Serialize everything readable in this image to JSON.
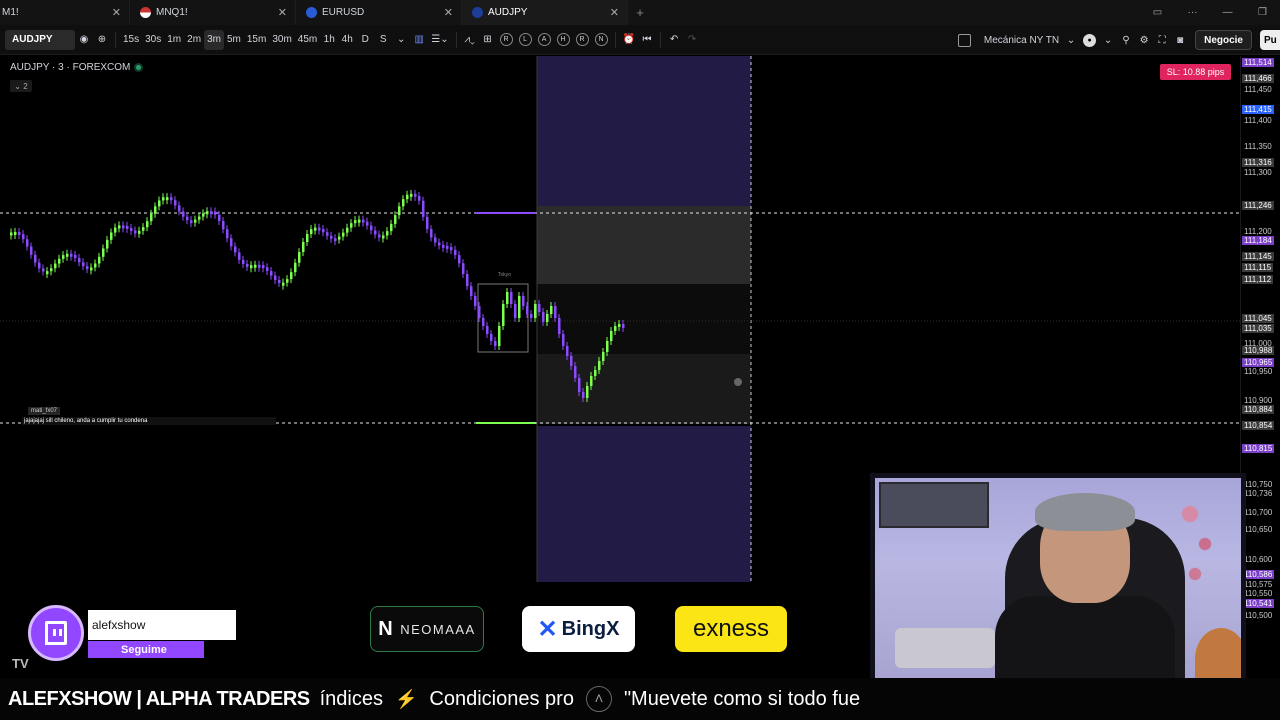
{
  "tabs": [
    {
      "label": "M1!",
      "icon": "none"
    },
    {
      "label": "MNQ1!",
      "icon": "us-flag-icon"
    },
    {
      "label": "EURUSD",
      "icon": "eu-flag-icon"
    },
    {
      "label": "AUDJPY",
      "icon": "au-flag-icon",
      "active": true
    }
  ],
  "toolbar": {
    "symbol": "AUDJPY",
    "intervals": [
      "15s",
      "30s",
      "1m",
      "2m",
      "3m",
      "5m",
      "15m",
      "30m",
      "45m",
      "1h",
      "4h",
      "D",
      "S"
    ],
    "selected_interval": "3m",
    "replay_letters": [
      "R",
      "L",
      "A",
      "H",
      "R",
      "N"
    ],
    "template_name": "Mecánica NY TN",
    "trade_button": "Negocie",
    "publish_button": "Pu"
  },
  "chart": {
    "legend": "AUDJPY · 3 · FOREXCOM",
    "collapse_label": "2",
    "sl_badge": "SL: 10.88 pips",
    "tokyo_label": "Tokyo",
    "chat_user": "mati_fx07",
    "chat_message": "jajajajaj sill chileno, anda a cumplir tu condena",
    "price_labels": [
      {
        "text": "111,514",
        "style": "badge-purple"
      },
      {
        "text": "111,466",
        "style": "badge-gray"
      },
      {
        "text": "111,450",
        "style": "plain"
      },
      {
        "text": "111,415",
        "style": "badge-blue"
      },
      {
        "text": "111,400",
        "style": "plain"
      },
      {
        "text": "111,350",
        "style": "plain"
      },
      {
        "text": "111,316",
        "style": "badge-gray"
      },
      {
        "text": "111,300",
        "style": "plain"
      },
      {
        "text": "111,246",
        "style": "badge-gray"
      },
      {
        "text": "111,200",
        "style": "plain"
      },
      {
        "text": "111,184",
        "style": "badge-purple"
      },
      {
        "text": "111,145",
        "style": "badge-gray"
      },
      {
        "text": "111,115",
        "style": "badge-gray"
      },
      {
        "text": "111,112",
        "style": "badge-gray"
      },
      {
        "text": "111,045",
        "style": "badge-gray"
      },
      {
        "text": "111,035",
        "style": "badge-gray"
      },
      {
        "text": "111,000",
        "style": "plain"
      },
      {
        "text": "110,988",
        "style": "badge-gray"
      },
      {
        "text": "110,965",
        "style": "badge-purple"
      },
      {
        "text": "110,950",
        "style": "plain"
      },
      {
        "text": "110,900",
        "style": "plain"
      },
      {
        "text": "110,884",
        "style": "badge-gray"
      },
      {
        "text": "110,854",
        "style": "badge-gray"
      },
      {
        "text": "110,815",
        "style": "badge-purple"
      },
      {
        "text": "110,750",
        "style": "plain"
      },
      {
        "text": "110,736",
        "style": "plain"
      },
      {
        "text": "110,700",
        "style": "plain"
      },
      {
        "text": "110,650",
        "style": "plain"
      },
      {
        "text": "110,600",
        "style": "plain"
      },
      {
        "text": "110,586",
        "style": "badge-purple"
      },
      {
        "text": "110,575",
        "style": "plain"
      },
      {
        "text": "110,550",
        "style": "plain"
      },
      {
        "text": "110,541",
        "style": "badge-purple"
      },
      {
        "text": "110,500",
        "style": "plain"
      }
    ]
  },
  "overlay": {
    "twitch_user": "alefxshow",
    "twitch_follow": "Seguime",
    "sponsors": [
      "NEOMAAA",
      "BingX",
      "exness"
    ],
    "ticker": {
      "brand": "ALEFXSHOW | ALPHA TRADERS",
      "items": [
        "índices",
        "Condiciones pro",
        "\"Muevete como si todo fue"
      ]
    }
  },
  "colors": {
    "bull": "#7cff4f",
    "bear": "#8d4bff",
    "session_box": "#221b45",
    "range_box": "#2b2b2b",
    "sl_badge": "#e0245e"
  }
}
